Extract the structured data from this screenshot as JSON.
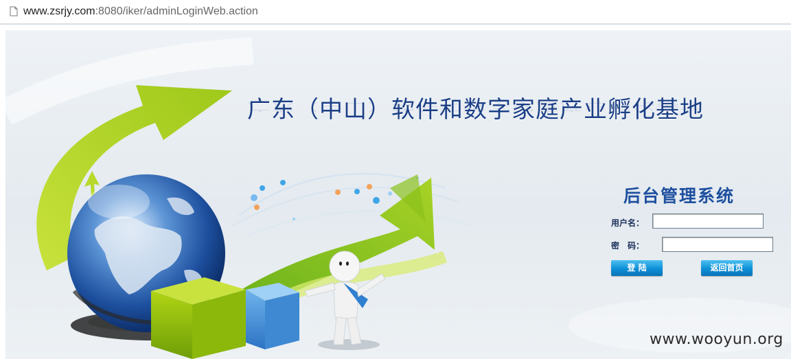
{
  "browser": {
    "url_host": "www.zsrjy.com",
    "url_rest": ":8080/iker/adminLoginWeb.action",
    "page_icon": "page-icon"
  },
  "banner": {
    "headline": "广东（中山）软件和数字家庭产业孵化基地",
    "system_title": "后台管理系统",
    "colors": {
      "headline": "#1b3f86",
      "system_title": "#1e4f9f",
      "button": "#0d8fd6",
      "arrow_green": "#a6cc1c"
    }
  },
  "login": {
    "username_label": "用户名：",
    "password_label": "密　码：",
    "username_value": "",
    "password_value": "",
    "login_button": "登 陆",
    "back_button": "返回首页"
  },
  "watermark": "www.wooyun.org"
}
